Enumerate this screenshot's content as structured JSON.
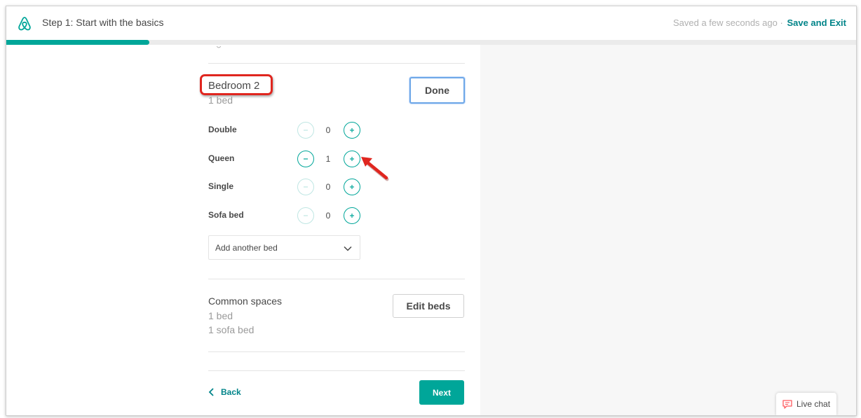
{
  "header": {
    "step_title": "Step 1: Start with the basics",
    "saved_status": "Saved a few seconds ago",
    "separator": "·",
    "save_exit": "Save and Exit"
  },
  "progress": {
    "fraction": 0.168,
    "color": "#00a699"
  },
  "bedroom": {
    "title": "Bedroom 2",
    "summary": "1 bed",
    "done_label": "Done",
    "beds": [
      {
        "type": "Double",
        "count": "0"
      },
      {
        "type": "Queen",
        "count": "1"
      },
      {
        "type": "Single",
        "count": "0"
      },
      {
        "type": "Sofa bed",
        "count": "0"
      }
    ],
    "add_bed_placeholder": "Add another bed"
  },
  "common_spaces": {
    "title": "Common spaces",
    "lines": [
      "1 bed",
      "1 sofa bed"
    ],
    "edit_label": "Edit beds"
  },
  "nav": {
    "back_label": "Back",
    "next_label": "Next"
  },
  "live_chat": {
    "label": "Live chat"
  },
  "icons": {
    "logo": "airbnb-logo-icon",
    "minus": "minus-icon",
    "plus": "plus-icon",
    "dropdown": "chevron-down-icon",
    "back": "chevron-left-icon",
    "chat": "chat-bubble-icon"
  },
  "colors": {
    "brand": "#00a699",
    "link": "#008489",
    "annotation": "#e0261f",
    "focus": "#6fa8e8"
  }
}
